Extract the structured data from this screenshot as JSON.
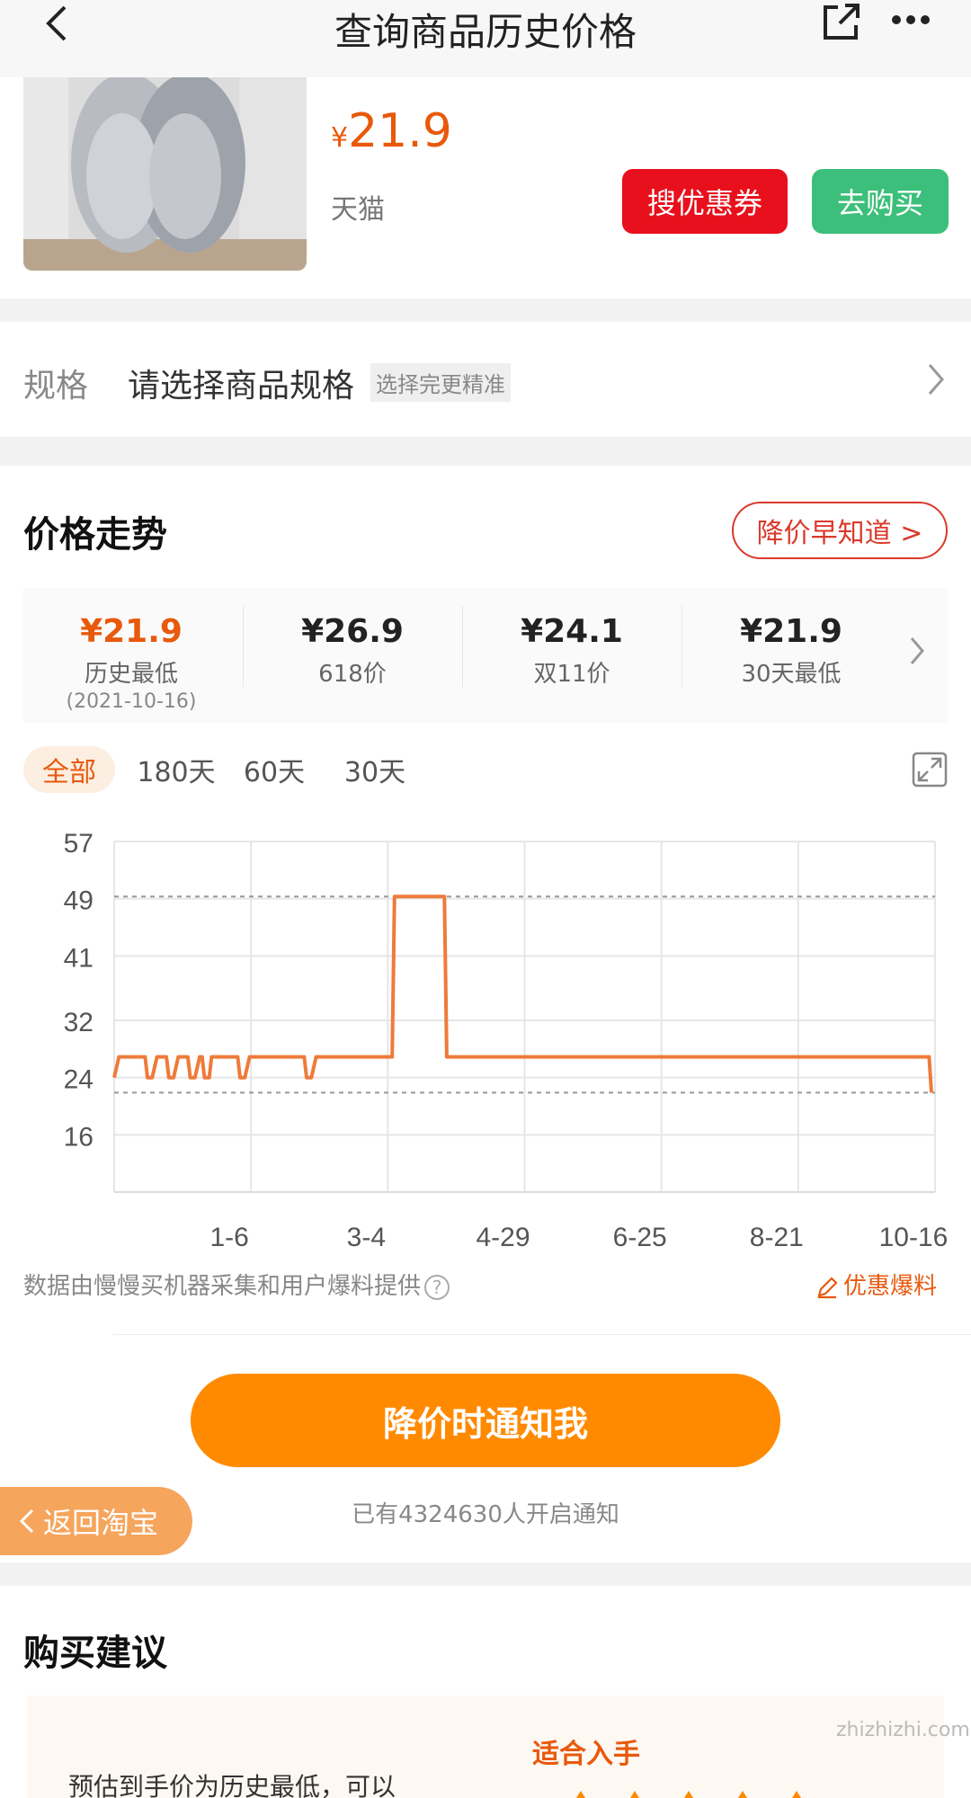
{
  "nav": {
    "title": "查询商品历史价格"
  },
  "product": {
    "currency": "¥",
    "price": "21.9",
    "platform": "天猫",
    "coupon_label": "搜优惠券",
    "buy_label": "去购买"
  },
  "spec": {
    "label": "规格",
    "value": "请选择商品规格",
    "hint": "选择完更精准"
  },
  "trend": {
    "title": "价格走势",
    "notify_label": "降价早知道 >",
    "stats": [
      {
        "price": "¥21.9",
        "label": "历史最低",
        "date": "(2021-10-16)"
      },
      {
        "price": "¥26.9",
        "label": "618价"
      },
      {
        "price": "¥24.1",
        "label": "双11价"
      },
      {
        "price": "¥21.9",
        "label": "30天最低"
      }
    ],
    "tabs": [
      "全部",
      "180天",
      "60天",
      "30天"
    ],
    "active_tab": "全部"
  },
  "chart_data": {
    "type": "line",
    "x_tick_labels": [
      "1-6",
      "3-4",
      "4-29",
      "6-25",
      "8-21",
      "10-16"
    ],
    "y_tick_labels": [
      "57",
      "49",
      "41",
      "32",
      "24",
      "16"
    ],
    "ylim": [
      8,
      57
    ],
    "reference_lines": [
      49.3,
      21.9
    ],
    "line_color": "#ee7b3a",
    "series": [
      {
        "x": [
          "11-07",
          "11-09",
          "11-20",
          "11-21",
          "11-23",
          "11-25",
          "11-29",
          "11-30",
          "12-02",
          "12-04",
          "12-08",
          "12-09",
          "12-11",
          "12-13",
          "12-14",
          "12-15",
          "12-17",
          "12-18",
          "12-29",
          "12-30",
          "01-01",
          "01-03",
          "01-26",
          "01-27",
          "01-29",
          "01-31",
          "03-04",
          "03-05",
          "03-26",
          "03-27",
          "10-16",
          "10-17"
        ],
        "y": [
          24,
          26.9,
          26.9,
          24,
          24,
          26.9,
          26.9,
          24,
          24,
          26.9,
          26.9,
          24,
          24,
          26.9,
          26.9,
          24,
          24,
          26.9,
          26.9,
          24,
          24,
          26.9,
          26.9,
          24,
          24,
          26.9,
          26.9,
          49.3,
          49.3,
          26.9,
          26.9,
          21.9
        ]
      }
    ]
  },
  "source": {
    "text": "数据由慢慢买机器采集和用户爆料提供",
    "help": "?",
    "report_label": "优惠爆料"
  },
  "notify_button": {
    "label": "降价时通知我"
  },
  "notify_count": "已有4324630人开启通知",
  "back_taobao": {
    "label": "返回淘宝"
  },
  "advice": {
    "title": "购买建议",
    "text": "预估到手价为历史最低，可以",
    "tag": "适合入手"
  },
  "watermark": "zhizhizhi.com"
}
